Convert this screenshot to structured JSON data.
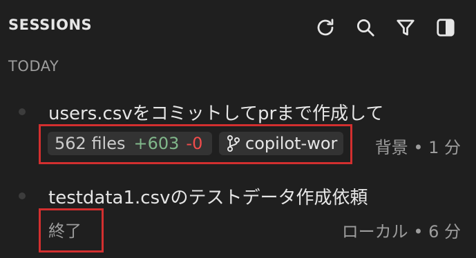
{
  "panel": {
    "title": "SESSIONS",
    "toolbar": {
      "refresh_icon": "refresh-icon",
      "search_icon": "search-icon",
      "filter_icon": "filter-icon",
      "toggle_panel_icon": "toggle-panel-icon"
    },
    "section_label": "TODAY"
  },
  "sessions": [
    {
      "title": "users.csvをコミットしてprまで作成して",
      "files": "562 files",
      "additions": "+603",
      "deletions": "-0",
      "branch": "copilot-wor",
      "meta": "背景 • 1 分"
    },
    {
      "title": "testdata1.csvのテストデータ作成依頼",
      "status": "終了",
      "meta": "ローカル • 6 分"
    }
  ],
  "colors": {
    "background": "#1f1f1f",
    "chip": "#333333",
    "addition": "#81b88b",
    "deletion": "#f14c4c",
    "annotation_box": "#d32f2f"
  }
}
